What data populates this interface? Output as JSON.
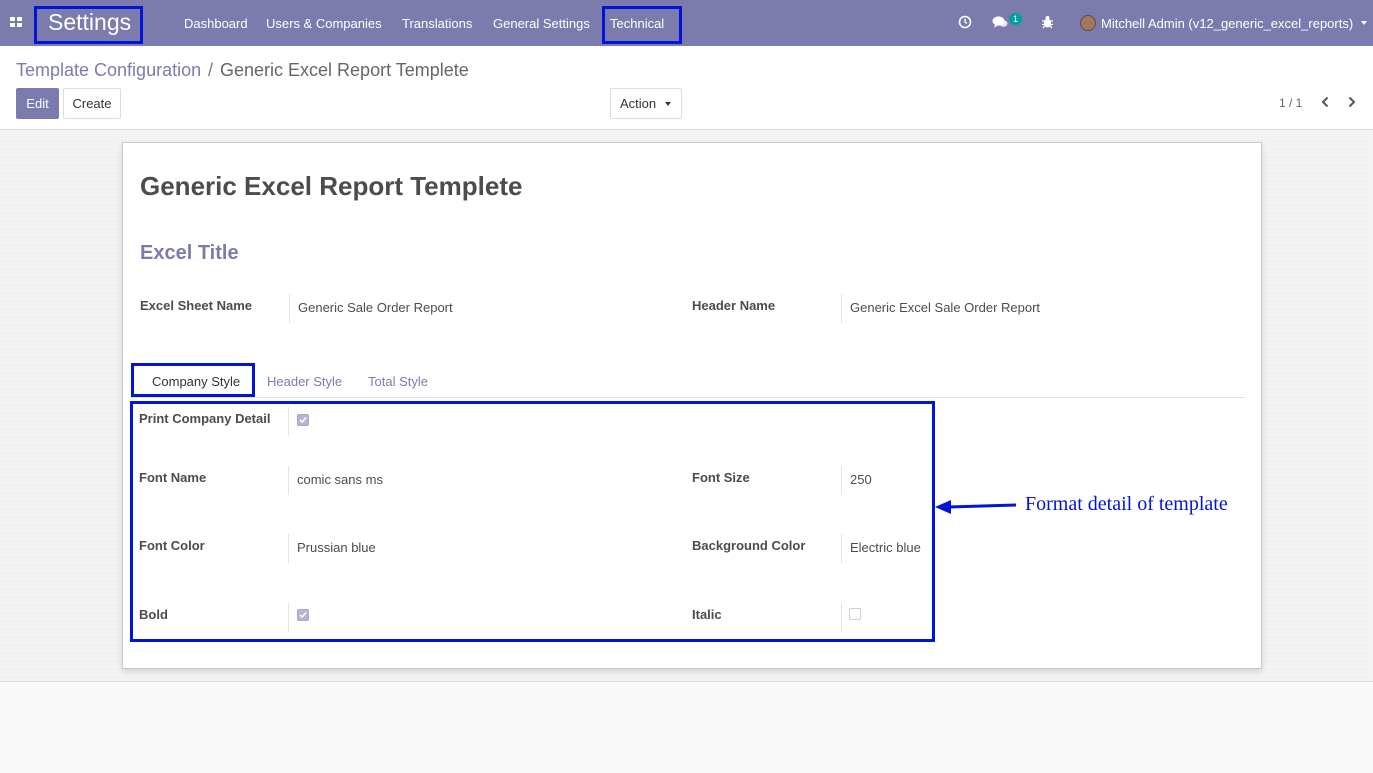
{
  "navbar": {
    "brand": "Settings",
    "menu": [
      "Dashboard",
      "Users & Companies",
      "Translations",
      "General Settings",
      "Technical"
    ],
    "messages_badge": "1",
    "user": "Mitchell Admin (v12_generic_excel_reports)"
  },
  "breadcrumb": {
    "parent": "Template Configuration",
    "separator": "/",
    "current": "Generic Excel Report Templete"
  },
  "buttons": {
    "edit": "Edit",
    "create": "Create",
    "action": "Action"
  },
  "pager": "1 / 1",
  "record": {
    "title": "Generic Excel Report Templete",
    "section": "Excel Title",
    "fields": {
      "sheet_name_label": "Excel Sheet Name",
      "sheet_name": "Generic Sale Order Report",
      "header_name_label": "Header Name",
      "header_name": "Generic Excel Sale Order Report"
    }
  },
  "tabs": [
    "Company Style",
    "Header Style",
    "Total Style"
  ],
  "company_style": {
    "print_company_detail_label": "Print Company Detail",
    "print_company_detail": true,
    "font_name_label": "Font Name",
    "font_name": "comic sans ms",
    "font_size_label": "Font Size",
    "font_size": "250",
    "font_color_label": "Font Color",
    "font_color": "Prussian blue",
    "background_color_label": "Background Color",
    "background_color": "Electric blue",
    "bold_label": "Bold",
    "bold": true,
    "italic_label": "Italic",
    "italic": false
  },
  "annotation": "Format detail of template",
  "colors": {
    "navbar": "#7c7bad",
    "highlight": "#0015d6",
    "primary": "#7c7bad"
  }
}
